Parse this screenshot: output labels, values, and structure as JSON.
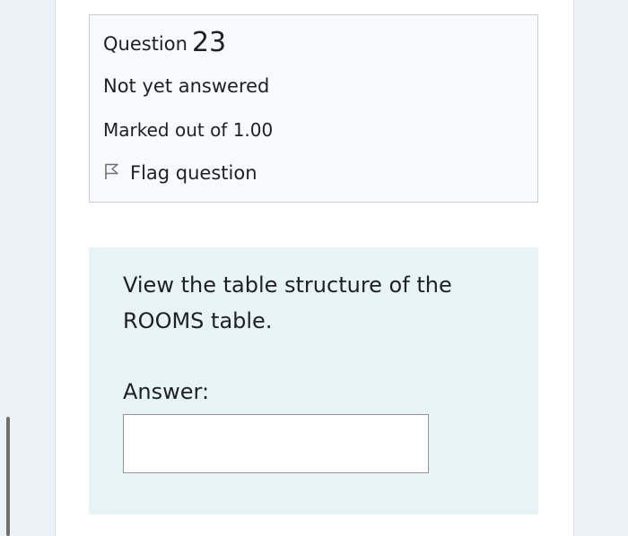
{
  "question_info": {
    "title_prefix": "Question",
    "number": "23",
    "state": "Not yet answered",
    "grade": "Marked out of 1.00",
    "flag_label": "Flag question",
    "flag_icon": "flag-outline-icon"
  },
  "question": {
    "text": "View the table structure of the ROOMS table.",
    "answer_label": "Answer:",
    "answer_value": ""
  },
  "colors": {
    "info_box_background": "#f8f9fa",
    "content_box_background": "#e7f3f5",
    "text": "#1d2125"
  }
}
